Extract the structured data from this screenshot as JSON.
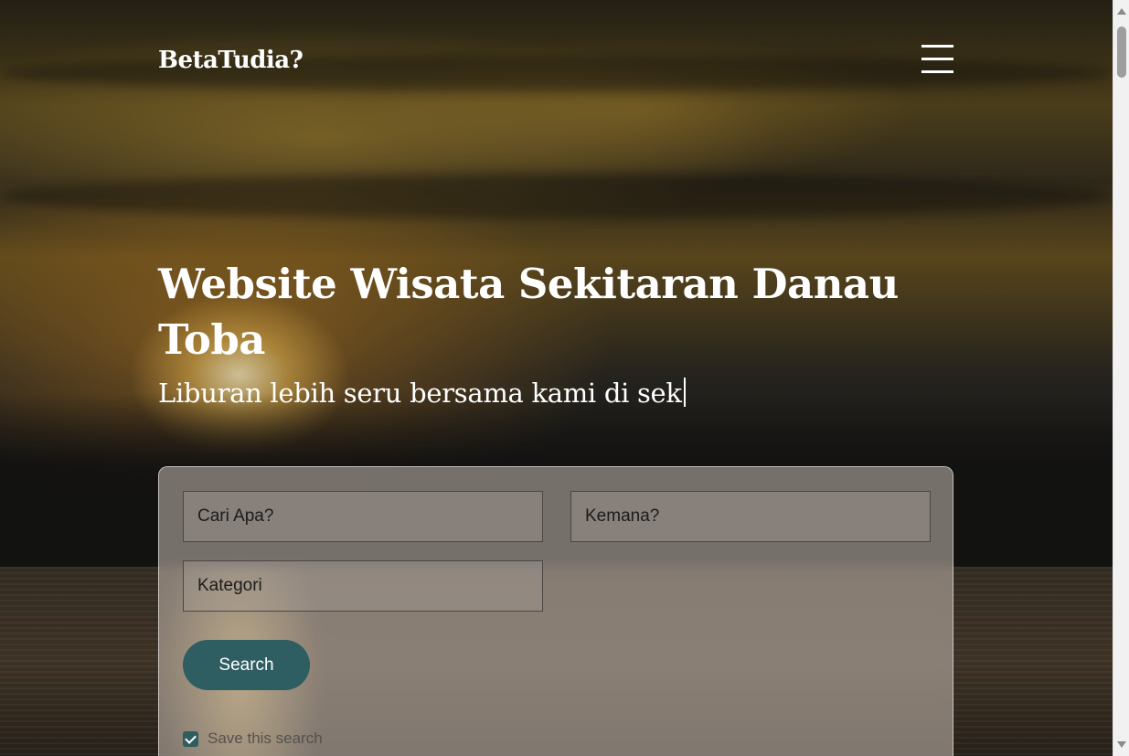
{
  "navbar": {
    "brand": "BetaTudia?",
    "menu_icon": "hamburger-menu-icon"
  },
  "hero": {
    "title": "Website Wisata Sekitaran Danau Toba",
    "subtitle": "Liburan lebih seru bersama kami di sek"
  },
  "search": {
    "what_placeholder": "Cari Apa?",
    "where_placeholder": "Kemana?",
    "category_placeholder": "Kategori",
    "button_label": "Search",
    "save_label": "Save this search",
    "save_checked": true
  },
  "colors": {
    "accent": "#2e5d62",
    "text_on_hero": "#ffffff"
  }
}
